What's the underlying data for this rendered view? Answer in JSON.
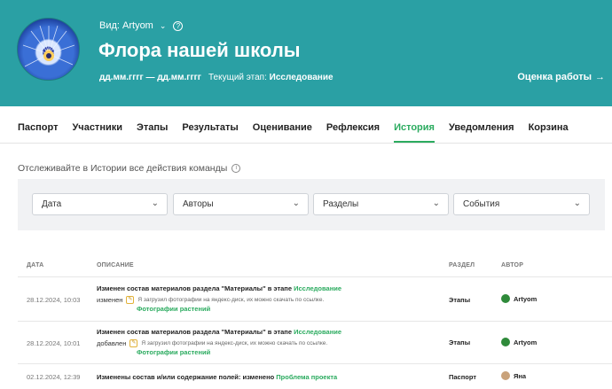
{
  "header": {
    "view_label": "Вид: Artyom",
    "help_glyph": "?",
    "title": "Флора нашей школы",
    "dates": "дд.мм.гггг — дд.мм.гггг",
    "stage_label": "Текущий этап:",
    "stage_value": "Исследование",
    "eval_link": "Оценка работы",
    "accent_color": "#2aa0a4"
  },
  "tabs": [
    {
      "label": "Паспорт"
    },
    {
      "label": "Участники"
    },
    {
      "label": "Этапы"
    },
    {
      "label": "Результаты"
    },
    {
      "label": "Оценивание"
    },
    {
      "label": "Рефлексия"
    },
    {
      "label": "История",
      "active": true
    },
    {
      "label": "Уведомления"
    },
    {
      "label": "Корзина"
    }
  ],
  "hint": "Отслеживайте в Истории все действия команды",
  "filters": {
    "date": "Дата",
    "authors": "Авторы",
    "sections": "Разделы",
    "events": "События"
  },
  "table": {
    "headers": {
      "date": "ДАТА",
      "description": "ОПИСАНИЕ",
      "section": "РАЗДЕЛ",
      "author": "АВТОР"
    },
    "rows": [
      {
        "date": "28.12.2024, 10:03",
        "title_prefix": "Изменен состав материалов раздела \"Материалы\" в этапе",
        "title_link": "Исследование",
        "action": "изменен",
        "comment": "Я загрузил фотографии на яндекс-диск, их можно скачать по ссылке.",
        "link": "Фотографии растений",
        "section": "Этапы",
        "author": "Artyom"
      },
      {
        "date": "28.12.2024, 10:01",
        "title_prefix": "Изменен состав материалов раздела \"Материалы\" в этапе",
        "title_link": "Исследование",
        "action": "добавлен",
        "comment": "Я загрузил фотографии на яндекс-диск, их можно скачать по ссылке.",
        "link": "Фотографии растений",
        "section": "Этапы",
        "author": "Artyom"
      },
      {
        "date": "02.12.2024, 12:39",
        "title_prefix": "Изменены состав и/или содержание полей: изменено",
        "title_link": "Проблема проекта",
        "section": "Паспорт",
        "author": "Яна"
      }
    ]
  }
}
